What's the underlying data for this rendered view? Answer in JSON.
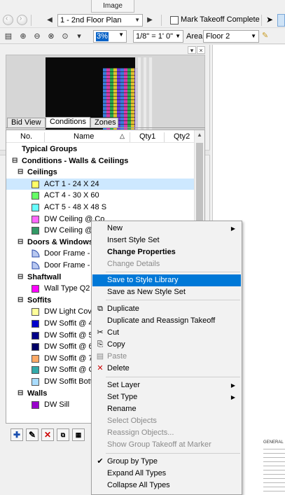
{
  "image_tab": "Image",
  "toolbar1": {
    "plan_select": "1 - 2nd Floor Plan",
    "mark_takeoff_label": "Mark Takeoff Complete"
  },
  "toolbar2": {
    "zoom_value": "3%",
    "scale_select": "1/8\" = 1' 0\"",
    "area_label": "Area",
    "area_select": "Floor 2"
  },
  "tabs": [
    "Bid View",
    "Conditions",
    "Zones"
  ],
  "columns": {
    "no": "No.",
    "name": "Name",
    "qty1": "Qty1",
    "qty2": "Qty2"
  },
  "rows": [
    {
      "text": "Typical Groups",
      "kind": "group0"
    },
    {
      "text": "Conditions - Walls & Ceilings",
      "kind": "group0exp"
    },
    {
      "text": "Ceilings",
      "kind": "group1"
    },
    {
      "text": "ACT 1 - 24 X 24",
      "kind": "item",
      "color": "#ffff66",
      "selected": true
    },
    {
      "text": "ACT 4 - 30 X 60",
      "kind": "item",
      "color": "#66ff66"
    },
    {
      "text": "ACT 5 - 48 X 48 S",
      "kind": "item",
      "color": "#66ffff"
    },
    {
      "text": "DW Ceiling @ Co",
      "kind": "item",
      "color": "#ff66ff"
    },
    {
      "text": "DW Ceiling @ Re",
      "kind": "item",
      "color": "#339966"
    },
    {
      "text": "Doors & Windows",
      "kind": "group1"
    },
    {
      "text": "Door Frame - LH",
      "kind": "door"
    },
    {
      "text": "Door Frame - RH",
      "kind": "door"
    },
    {
      "text": "Shaftwall",
      "kind": "group1"
    },
    {
      "text": "Wall Type Q2 @",
      "kind": "item",
      "color": "#ff00ff"
    },
    {
      "text": "Soffits",
      "kind": "group1"
    },
    {
      "text": "DW Light Cove @",
      "kind": "item",
      "color": "#ffff99"
    },
    {
      "text": "DW Soffit @ 4'",
      "kind": "item",
      "color": "#0000cc"
    },
    {
      "text": "DW Soffit @ 5'",
      "kind": "item",
      "color": "#000088"
    },
    {
      "text": "DW Soffit @ 6'",
      "kind": "item",
      "color": "#000066"
    },
    {
      "text": "DW Soffit @ 7'",
      "kind": "item",
      "color": "#ffaa66"
    },
    {
      "text": "DW Soffit @ Cab",
      "kind": "item",
      "color": "#33aaaa"
    },
    {
      "text": "DW Soffit Bottom",
      "kind": "item",
      "color": "#aaddff"
    },
    {
      "text": "Walls",
      "kind": "group1"
    },
    {
      "text": "DW Sill",
      "kind": "item",
      "color": "#9900cc"
    }
  ],
  "context_menu": {
    "new": "New",
    "insert_style_set": "Insert Style Set",
    "change_properties": "Change Properties",
    "change_details": "Change Details",
    "save_to_style_library": "Save to Style Library",
    "save_as_new_style_set": "Save as New Style Set",
    "duplicate": "Duplicate",
    "duplicate_reassign": "Duplicate and Reassign Takeoff",
    "cut": "Cut",
    "copy": "Copy",
    "paste": "Paste",
    "delete": "Delete",
    "set_layer": "Set Layer",
    "set_type": "Set Type",
    "rename": "Rename",
    "select_objects": "Select Objects",
    "reassign_objects": "Reassign Objects...",
    "show_group_takeoff": "Show Group Takeoff at Marker",
    "group_by_type": "Group by Type",
    "expand_all": "Expand All Types",
    "collapse_all": "Collapse All Types"
  },
  "right_area": {
    "general_title": "GENERAL"
  },
  "accent_color": "#0078d7"
}
